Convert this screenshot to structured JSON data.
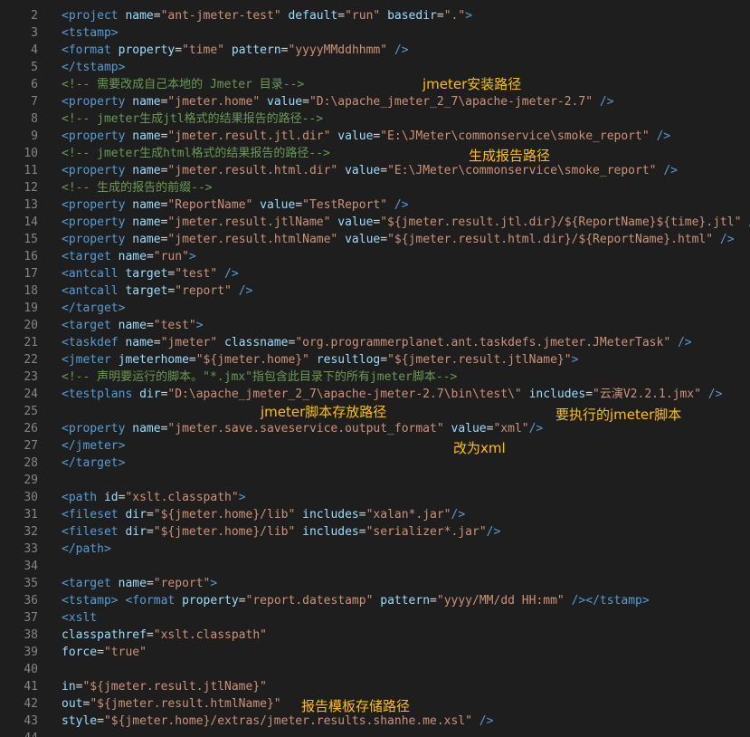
{
  "colors": {
    "background": "#1e1e1e",
    "line_number": "#858585",
    "tag": "#569cd6",
    "attribute": "#9cdcfe",
    "string": "#ce9178",
    "comment": "#6a9955",
    "text": "#d4d4d4",
    "annotation": "#ffc000"
  },
  "lines": [
    {
      "n": "2",
      "tokens": [
        [
          "t-tag",
          "<project "
        ],
        [
          "t-attr",
          "name"
        ],
        [
          "t-txt",
          "="
        ],
        [
          "t-str",
          "\"ant-jmeter-test\""
        ],
        [
          "t-txt",
          " "
        ],
        [
          "t-attr",
          "default"
        ],
        [
          "t-txt",
          "="
        ],
        [
          "t-str",
          "\"run\""
        ],
        [
          "t-txt",
          " "
        ],
        [
          "t-attr",
          "basedir"
        ],
        [
          "t-txt",
          "="
        ],
        [
          "t-str",
          "\".\""
        ],
        [
          "t-tag",
          ">"
        ]
      ]
    },
    {
      "n": "3",
      "tokens": [
        [
          "t-tag",
          "<tstamp>"
        ]
      ]
    },
    {
      "n": "4",
      "tokens": [
        [
          "t-tag",
          "<format "
        ],
        [
          "t-attr",
          "property"
        ],
        [
          "t-txt",
          "="
        ],
        [
          "t-str",
          "\"time\""
        ],
        [
          "t-txt",
          " "
        ],
        [
          "t-attr",
          "pattern"
        ],
        [
          "t-txt",
          "="
        ],
        [
          "t-str",
          "\"yyyyMMddhhmm\""
        ],
        [
          "t-txt",
          " "
        ],
        [
          "t-tag",
          "/>"
        ]
      ]
    },
    {
      "n": "5",
      "tokens": [
        [
          "t-tag",
          "</tstamp>"
        ]
      ]
    },
    {
      "n": "6",
      "tokens": [
        [
          "t-cmt",
          "<!-- 需要改成自己本地的 Jmeter 目录-->"
        ]
      ]
    },
    {
      "n": "7",
      "tokens": [
        [
          "t-tag",
          "<property "
        ],
        [
          "t-attr",
          "name"
        ],
        [
          "t-txt",
          "="
        ],
        [
          "t-str",
          "\"jmeter.home\""
        ],
        [
          "t-txt",
          " "
        ],
        [
          "t-attr",
          "value"
        ],
        [
          "t-txt",
          "="
        ],
        [
          "t-str",
          "\"D:\\apache_jmeter_2_7\\apache-jmeter-2.7\""
        ],
        [
          "t-txt",
          " "
        ],
        [
          "t-tag",
          "/>"
        ]
      ]
    },
    {
      "n": "8",
      "tokens": [
        [
          "t-cmt",
          "<!-- jmeter生成jtl格式的结果报告的路径-->"
        ]
      ]
    },
    {
      "n": "9",
      "tokens": [
        [
          "t-tag",
          "<property "
        ],
        [
          "t-attr",
          "name"
        ],
        [
          "t-txt",
          "="
        ],
        [
          "t-str",
          "\"jmeter.result.jtl.dir\""
        ],
        [
          "t-txt",
          " "
        ],
        [
          "t-attr",
          "value"
        ],
        [
          "t-txt",
          "="
        ],
        [
          "t-str",
          "\"E:\\JMeter\\commonservice\\smoke_report\""
        ],
        [
          "t-txt",
          " "
        ],
        [
          "t-tag",
          "/>"
        ]
      ]
    },
    {
      "n": "10",
      "tokens": [
        [
          "t-cmt",
          "<!-- jmeter生成html格式的结果报告的路径-->"
        ]
      ]
    },
    {
      "n": "11",
      "tokens": [
        [
          "t-tag",
          "<property "
        ],
        [
          "t-attr",
          "name"
        ],
        [
          "t-txt",
          "="
        ],
        [
          "t-str",
          "\"jmeter.result.html.dir\""
        ],
        [
          "t-txt",
          " "
        ],
        [
          "t-attr",
          "value"
        ],
        [
          "t-txt",
          "="
        ],
        [
          "t-str",
          "\"E:\\JMeter\\commonservice\\smoke_report\""
        ],
        [
          "t-txt",
          " "
        ],
        [
          "t-tag",
          "/>"
        ]
      ]
    },
    {
      "n": "12",
      "tokens": [
        [
          "t-cmt",
          "<!-- 生成的报告的前缀-->"
        ]
      ]
    },
    {
      "n": "13",
      "tokens": [
        [
          "t-tag",
          "<property "
        ],
        [
          "t-attr",
          "name"
        ],
        [
          "t-txt",
          "="
        ],
        [
          "t-str",
          "\"ReportName\""
        ],
        [
          "t-txt",
          " "
        ],
        [
          "t-attr",
          "value"
        ],
        [
          "t-txt",
          "="
        ],
        [
          "t-str",
          "\"TestReport\""
        ],
        [
          "t-txt",
          " "
        ],
        [
          "t-tag",
          "/>"
        ]
      ]
    },
    {
      "n": "14",
      "tokens": [
        [
          "t-tag",
          "<property "
        ],
        [
          "t-attr",
          "name"
        ],
        [
          "t-txt",
          "="
        ],
        [
          "t-str",
          "\"jmeter.result.jtlName\""
        ],
        [
          "t-txt",
          " "
        ],
        [
          "t-attr",
          "value"
        ],
        [
          "t-txt",
          "="
        ],
        [
          "t-str",
          "\"${jmeter.result.jtl.dir}/${ReportName}${time}.jtl\""
        ],
        [
          "t-txt",
          " "
        ],
        [
          "t-tag",
          "/>"
        ]
      ]
    },
    {
      "n": "15",
      "tokens": [
        [
          "t-tag",
          "<property "
        ],
        [
          "t-attr",
          "name"
        ],
        [
          "t-txt",
          "="
        ],
        [
          "t-str",
          "\"jmeter.result.htmlName\""
        ],
        [
          "t-txt",
          " "
        ],
        [
          "t-attr",
          "value"
        ],
        [
          "t-txt",
          "="
        ],
        [
          "t-str",
          "\"${jmeter.result.html.dir}/${ReportName}.html\""
        ],
        [
          "t-txt",
          " "
        ],
        [
          "t-tag",
          "/>"
        ]
      ]
    },
    {
      "n": "16",
      "tokens": [
        [
          "t-tag",
          "<target "
        ],
        [
          "t-attr",
          "name"
        ],
        [
          "t-txt",
          "="
        ],
        [
          "t-str",
          "\"run\""
        ],
        [
          "t-tag",
          ">"
        ]
      ]
    },
    {
      "n": "17",
      "tokens": [
        [
          "t-tag",
          "<antcall "
        ],
        [
          "t-attr",
          "target"
        ],
        [
          "t-txt",
          "="
        ],
        [
          "t-str",
          "\"test\""
        ],
        [
          "t-txt",
          " "
        ],
        [
          "t-tag",
          "/>"
        ]
      ]
    },
    {
      "n": "18",
      "tokens": [
        [
          "t-tag",
          "<antcall "
        ],
        [
          "t-attr",
          "target"
        ],
        [
          "t-txt",
          "="
        ],
        [
          "t-str",
          "\"report\""
        ],
        [
          "t-txt",
          " "
        ],
        [
          "t-tag",
          "/>"
        ]
      ]
    },
    {
      "n": "19",
      "tokens": [
        [
          "t-tag",
          "</target>"
        ]
      ]
    },
    {
      "n": "20",
      "tokens": [
        [
          "t-tag",
          "<target "
        ],
        [
          "t-attr",
          "name"
        ],
        [
          "t-txt",
          "="
        ],
        [
          "t-str",
          "\"test\""
        ],
        [
          "t-tag",
          ">"
        ]
      ]
    },
    {
      "n": "21",
      "tokens": [
        [
          "t-tag",
          "<taskdef "
        ],
        [
          "t-attr",
          "name"
        ],
        [
          "t-txt",
          "="
        ],
        [
          "t-str",
          "\"jmeter\""
        ],
        [
          "t-txt",
          " "
        ],
        [
          "t-attr",
          "classname"
        ],
        [
          "t-txt",
          "="
        ],
        [
          "t-str",
          "\"org.programmerplanet.ant.taskdefs.jmeter.JMeterTask\""
        ],
        [
          "t-txt",
          " "
        ],
        [
          "t-tag",
          "/>"
        ]
      ]
    },
    {
      "n": "22",
      "tokens": [
        [
          "t-tag",
          "<jmeter "
        ],
        [
          "t-attr",
          "jmeterhome"
        ],
        [
          "t-txt",
          "="
        ],
        [
          "t-str",
          "\"${jmeter.home}\""
        ],
        [
          "t-txt",
          " "
        ],
        [
          "t-attr",
          "resultlog"
        ],
        [
          "t-txt",
          "="
        ],
        [
          "t-str",
          "\"${jmeter.result.jtlName}\""
        ],
        [
          "t-tag",
          ">"
        ]
      ]
    },
    {
      "n": "23",
      "tokens": [
        [
          "t-cmt",
          "<!-- 声明要运行的脚本。\"*.jmx\"指包含此目录下的所有jmeter脚本-->"
        ]
      ]
    },
    {
      "n": "24",
      "tokens": [
        [
          "t-tag",
          "<testplans "
        ],
        [
          "t-attr",
          "dir"
        ],
        [
          "t-txt",
          "="
        ],
        [
          "t-str",
          "\"D:\\apache_jmeter_2_7\\apache-jmeter-2.7\\bin\\test\\\""
        ],
        [
          "t-txt",
          " "
        ],
        [
          "t-attr",
          "includes"
        ],
        [
          "t-txt",
          "="
        ],
        [
          "t-str",
          "\"云演V2.2.1.jmx\""
        ],
        [
          "t-txt",
          " "
        ],
        [
          "t-tag",
          "/>"
        ]
      ]
    },
    {
      "n": "25",
      "tokens": []
    },
    {
      "n": "26",
      "tokens": [
        [
          "t-tag",
          "<property "
        ],
        [
          "t-attr",
          "name"
        ],
        [
          "t-txt",
          "="
        ],
        [
          "t-str",
          "\"jmeter.save.saveservice.output_format\""
        ],
        [
          "t-txt",
          " "
        ],
        [
          "t-attr",
          "value"
        ],
        [
          "t-txt",
          "="
        ],
        [
          "t-str",
          "\"xml\""
        ],
        [
          "t-tag",
          "/>"
        ]
      ]
    },
    {
      "n": "27",
      "tokens": [
        [
          "t-tag",
          "</jmeter>"
        ]
      ]
    },
    {
      "n": "28",
      "tokens": [
        [
          "t-tag",
          "</target>"
        ]
      ]
    },
    {
      "n": "29",
      "tokens": []
    },
    {
      "n": "30",
      "tokens": [
        [
          "t-tag",
          "<path "
        ],
        [
          "t-attr",
          "id"
        ],
        [
          "t-txt",
          "="
        ],
        [
          "t-str",
          "\"xslt.classpath\""
        ],
        [
          "t-tag",
          ">"
        ]
      ]
    },
    {
      "n": "31",
      "tokens": [
        [
          "t-tag",
          "<fileset "
        ],
        [
          "t-attr",
          "dir"
        ],
        [
          "t-txt",
          "="
        ],
        [
          "t-str",
          "\"${jmeter.home}/lib\""
        ],
        [
          "t-txt",
          " "
        ],
        [
          "t-attr",
          "includes"
        ],
        [
          "t-txt",
          "="
        ],
        [
          "t-str",
          "\"xalan*.jar\""
        ],
        [
          "t-tag",
          "/>"
        ]
      ]
    },
    {
      "n": "32",
      "tokens": [
        [
          "t-tag",
          "<fileset "
        ],
        [
          "t-attr",
          "dir"
        ],
        [
          "t-txt",
          "="
        ],
        [
          "t-str",
          "\"${jmeter.home}/lib\""
        ],
        [
          "t-txt",
          " "
        ],
        [
          "t-attr",
          "includes"
        ],
        [
          "t-txt",
          "="
        ],
        [
          "t-str",
          "\"serializer*.jar\""
        ],
        [
          "t-tag",
          "/>"
        ]
      ]
    },
    {
      "n": "33",
      "tokens": [
        [
          "t-tag",
          "</path>"
        ]
      ]
    },
    {
      "n": "34",
      "tokens": []
    },
    {
      "n": "35",
      "tokens": [
        [
          "t-tag",
          "<target "
        ],
        [
          "t-attr",
          "name"
        ],
        [
          "t-txt",
          "="
        ],
        [
          "t-str",
          "\"report\""
        ],
        [
          "t-tag",
          ">"
        ]
      ]
    },
    {
      "n": "36",
      "tokens": [
        [
          "t-tag",
          "<tstamp>"
        ],
        [
          "t-txt",
          " "
        ],
        [
          "t-tag",
          "<format "
        ],
        [
          "t-attr",
          "property"
        ],
        [
          "t-txt",
          "="
        ],
        [
          "t-str",
          "\"report.datestamp\""
        ],
        [
          "t-txt",
          " "
        ],
        [
          "t-attr",
          "pattern"
        ],
        [
          "t-txt",
          "="
        ],
        [
          "t-str",
          "\"yyyy/MM/dd HH:mm\""
        ],
        [
          "t-txt",
          " "
        ],
        [
          "t-tag",
          "/></tstamp>"
        ]
      ]
    },
    {
      "n": "37",
      "tokens": [
        [
          "t-tag",
          "<xslt"
        ]
      ]
    },
    {
      "n": "38",
      "tokens": [
        [
          "t-attr",
          "classpathref"
        ],
        [
          "t-txt",
          "="
        ],
        [
          "t-str",
          "\"xslt.classpath\""
        ]
      ]
    },
    {
      "n": "39",
      "tokens": [
        [
          "t-attr",
          "force"
        ],
        [
          "t-txt",
          "="
        ],
        [
          "t-str",
          "\"true\""
        ]
      ]
    },
    {
      "n": "40",
      "tokens": []
    },
    {
      "n": "41",
      "tokens": [
        [
          "t-attr",
          "in"
        ],
        [
          "t-txt",
          "="
        ],
        [
          "t-str",
          "\"${jmeter.result.jtlName}\""
        ]
      ]
    },
    {
      "n": "42",
      "tokens": [
        [
          "t-attr",
          "out"
        ],
        [
          "t-txt",
          "="
        ],
        [
          "t-str",
          "\"${jmeter.result.htmlName}\""
        ]
      ]
    },
    {
      "n": "43",
      "tokens": [
        [
          "t-attr",
          "style"
        ],
        [
          "t-txt",
          "="
        ],
        [
          "t-str",
          "\"${jmeter.home}/extras/jmeter.results.shanhe.me.xsl\""
        ],
        [
          "t-txt",
          " "
        ],
        [
          "t-tag",
          "/>"
        ]
      ]
    },
    {
      "n": "44",
      "tokens": []
    }
  ],
  "annotations": {
    "jmeter_install_path": "jmeter安装路径",
    "report_output_path": "生成报告路径",
    "script_location": "jmeter脚本存放路径",
    "script_to_run": "要执行的jmeter脚本",
    "change_to_xml": "改为xml",
    "report_template_path": "报告模板存储路径"
  }
}
